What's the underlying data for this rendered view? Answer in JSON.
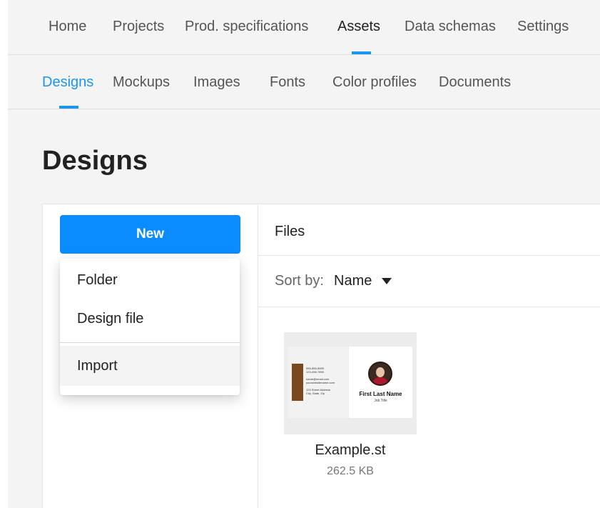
{
  "colors": {
    "accent": "#1a96f0",
    "primary_button": "#0a8cff",
    "import_highlight": "#f4f4f4"
  },
  "top_nav": {
    "items": [
      "Home",
      "Projects",
      "Prod. specifications",
      "Assets",
      "Data schemas",
      "Settings"
    ],
    "active": "Assets"
  },
  "sub_nav": {
    "items": [
      "Designs",
      "Mockups",
      "Images",
      "Fonts",
      "Color profiles",
      "Documents"
    ],
    "active": "Designs"
  },
  "page": {
    "title": "Designs"
  },
  "new_menu": {
    "button_label": "New",
    "options": [
      "Folder",
      "Design file",
      "Import"
    ],
    "highlighted": "Import"
  },
  "files": {
    "header": "Files",
    "sort_label": "Sort by:",
    "sort_value": "Name",
    "items": [
      {
        "name": "Example.st",
        "size": "262.5 KB",
        "thumbnail": {
          "contact_lines": "555-555-5555\n123-456-7890\n\nname@email.com\nyourwebsitename.com\n\n123 Street Address\nCity, State, Zip",
          "person_name": "First Last Name",
          "job_title": "Job Title"
        }
      }
    ]
  }
}
